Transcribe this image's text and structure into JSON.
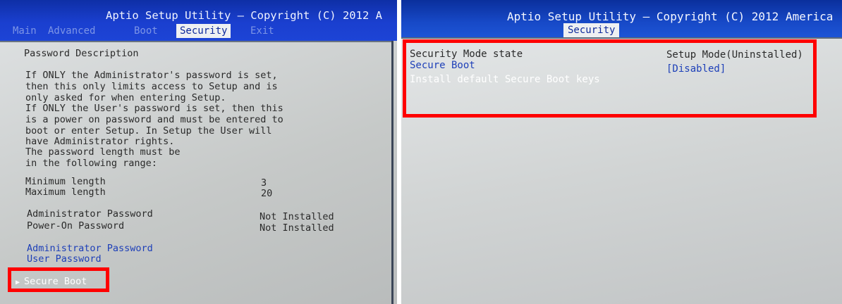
{
  "left": {
    "title": "Aptio Setup Utility – Copyright (C) 2012 A",
    "tabs": [
      "Main",
      "Advanced",
      "Boot",
      "Security",
      "Exit"
    ],
    "active_tab": "Security",
    "description": [
      "Password Description",
      "If ONLY the Administrator's password is set,",
      "then this only limits access to Setup and is",
      "only asked for when entering Setup.",
      "If ONLY the User's password is set, then this",
      "is a power on password and must be entered to",
      "boot or enter Setup. In Setup the User will",
      "have Administrator rights.",
      "The password length must be",
      "in the following range:"
    ],
    "min_label": "Minimum length",
    "min_value": "3",
    "max_label": "Maximum length",
    "max_value": "20",
    "admin_pw_label": "Administrator Password",
    "admin_pw_value": "Not Installed",
    "poweron_pw_label": "Power-On Password",
    "poweron_pw_value": "Not Installed",
    "admin_pw_link": "Administrator Password",
    "user_pw_link": "User Password",
    "secure_boot_item": "Secure Boot",
    "arrow": "▶"
  },
  "right": {
    "title": "Aptio Setup Utility – Copyright (C) 2012 America",
    "active_tab": "Security",
    "mode_label": "Security Mode state",
    "mode_value": "Setup Mode(Uninstalled)",
    "secure_boot_label": "Secure Boot",
    "secure_boot_value": "[Disabled]",
    "install_keys": "Install default Secure Boot keys"
  },
  "colors": {
    "highlight": "#ff0000",
    "header_blue": "#1a3fcf"
  }
}
